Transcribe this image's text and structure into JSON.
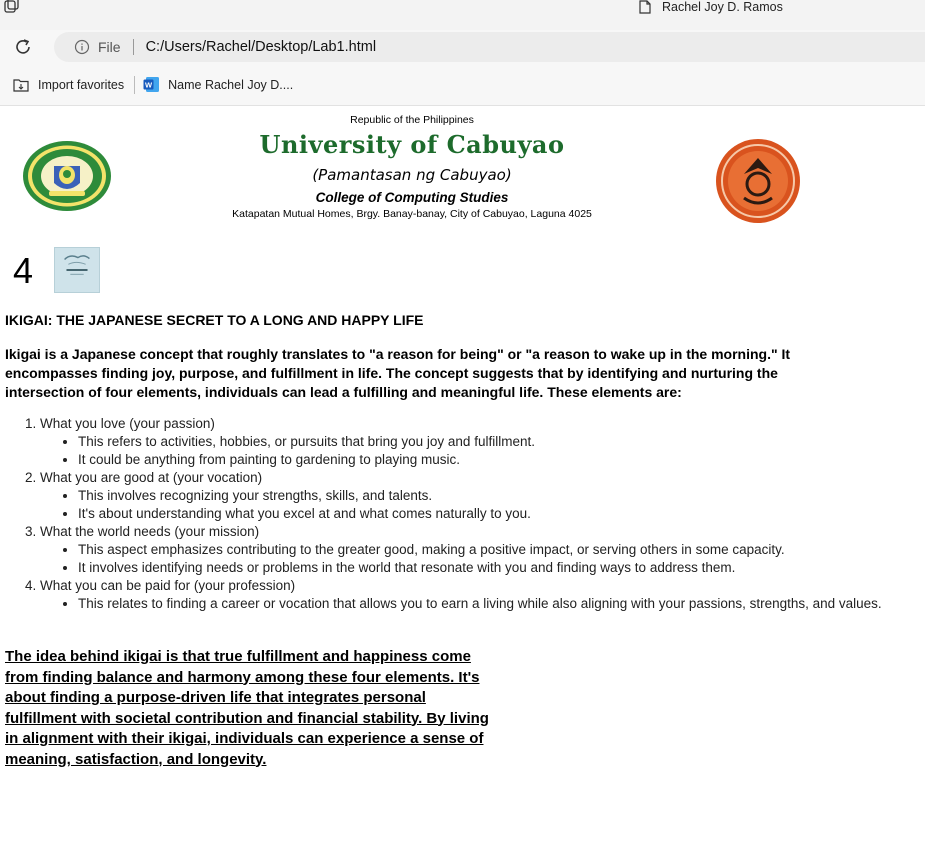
{
  "browser": {
    "tab_title": "Rachel Joy D. Ramos",
    "address": {
      "file_label": "File",
      "url": "C:/Users/Rachel/Desktop/Lab1.html"
    },
    "favorites": [
      {
        "label": "Import favorites",
        "icon": "import-favorites-icon"
      },
      {
        "label": "Name Rachel Joy D....",
        "icon": "word-document-icon"
      }
    ]
  },
  "header": {
    "republic": "Republic of the Philippines",
    "university": "University of Cabuyao",
    "pamantasan": "(Pamantasan ng Cabuyao)",
    "college": "College of Computing Studies",
    "address": "Katapatan Mutual Homes, Brgy. Banay-banay, City of Cabuyao, Laguna 4025",
    "logos": [
      "university-seal-logo",
      "college-seal-logo"
    ]
  },
  "content": {
    "number": "4",
    "title": "IKIGAI: THE JAPANESE SECRET TO A LONG AND HAPPY LIFE",
    "intro": "Ikigai is a Japanese concept that roughly translates to \"a reason for being\" or \"a reason to wake up in the morning.\" It encompasses finding joy, purpose, and fulfillment in life. The concept suggests that by identifying and nurturing the intersection of four elements, individuals can lead a fulfilling and meaningful life. These elements are:",
    "elements": [
      {
        "heading": "What you love (your passion)",
        "points": [
          "This refers to activities, hobbies, or pursuits that bring you joy and fulfillment.",
          "It could be anything from painting to gardening to playing music."
        ]
      },
      {
        "heading": "What you are good at (your vocation)",
        "points": [
          "This involves recognizing your strengths, skills, and talents.",
          "It's about understanding what you excel at and what comes naturally to you."
        ]
      },
      {
        "heading": "What the world needs (your mission)",
        "points": [
          "This aspect emphasizes contributing to the greater good, making a positive impact, or serving others in some capacity.",
          "It involves identifying needs or problems in the world that resonate with you and finding ways to address them."
        ]
      },
      {
        "heading": "What you can be paid for (your profession)",
        "points": [
          "This relates to finding a career or vocation that allows you to earn a living while also aligning with your passions, strengths, and values."
        ]
      }
    ],
    "conclusion": "The idea behind ikigai is that true fulfillment and happiness come from finding balance and harmony among these four elements. It's about finding a purpose-driven life that integrates personal fulfillment with societal contribution and financial stability. By living in alignment with their ikigai, individuals can experience a sense of meaning, satisfaction, and longevity."
  },
  "colors": {
    "university_green": "#1d6b2c",
    "seal_green": "#2e8b3a",
    "seal_orange": "#e0632a",
    "word_blue": "#185abd"
  }
}
